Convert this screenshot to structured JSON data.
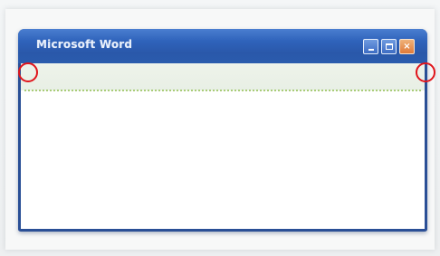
{
  "window": {
    "title": "Microsoft Word",
    "controls": {
      "minimize": "minimize-button",
      "maximize": "maximize-button",
      "close": "close-button",
      "close_glyph": "×"
    }
  },
  "colors": {
    "titlebar": "#2f63bb",
    "frame": "#2a4f96",
    "close_button": "#e07a3a",
    "guide_dots": "#a9cc78",
    "markers": "#e0141b"
  },
  "icons": [
    "minimize-icon",
    "maximize-icon",
    "close-icon"
  ],
  "annotations": {
    "markers": [
      "red-circle-marker-left",
      "red-circle-marker-right"
    ]
  }
}
